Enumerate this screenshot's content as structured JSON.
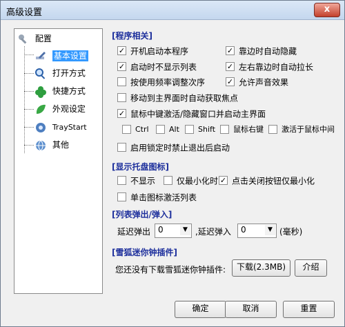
{
  "window": {
    "title": "高级设置",
    "close_symbol": "x"
  },
  "tree": {
    "root": "配置",
    "items": [
      {
        "label": "基本设置",
        "icon": "pen-icon",
        "selected": true
      },
      {
        "label": "打开方式",
        "icon": "magnifier-icon"
      },
      {
        "label": "快捷方式",
        "icon": "clover-icon"
      },
      {
        "label": "外观设定",
        "icon": "leaf-icon"
      },
      {
        "label": "TrayStart",
        "icon": "gear-globe-icon"
      },
      {
        "label": "其他",
        "icon": "globe-icon"
      }
    ]
  },
  "sections": {
    "program": "[程序相关]",
    "tray": "[显示托盘图标]",
    "list": "[列表弹出/弹入]",
    "plugin": "[雪狐迷你钟插件]"
  },
  "program_options": [
    {
      "label": "开机启动本程序",
      "checked": true
    },
    {
      "label": "靠边时自动隐藏",
      "checked": true
    },
    {
      "label": "启动时不显示列表",
      "checked": true
    },
    {
      "label": "左右靠边时自动拉长",
      "checked": true
    },
    {
      "label": "按使用频率调整次序",
      "checked": false
    },
    {
      "label": "允许声音效果",
      "checked": true
    },
    {
      "label": "移动到主界面时自动获取焦点",
      "checked": false
    },
    {
      "label": "鼠标中键激活/隐藏窗口并启动主界面",
      "checked": true
    }
  ],
  "hotkey_modifiers": [
    {
      "label": "Ctrl",
      "checked": false
    },
    {
      "label": "Alt",
      "checked": false
    },
    {
      "label": "Shift",
      "checked": false
    },
    {
      "label": "鼠标右键",
      "checked": false
    },
    {
      "label": "激活于鼠标中间",
      "checked": false
    }
  ],
  "lock_option": {
    "label": "启用锁定时禁止退出后启动",
    "checked": false
  },
  "tray_options": [
    {
      "label": "不显示",
      "checked": false
    },
    {
      "label": "仅最小化时",
      "checked": false
    },
    {
      "label": "点击关闭按钮仅最小化",
      "checked": true
    },
    {
      "label": "单击图标激活列表",
      "checked": false
    }
  ],
  "list_delay": {
    "popup_label": "延迟弹出",
    "popup_value": "0",
    "hide_label": ",延迟弹入",
    "hide_value": "0",
    "unit": "(毫秒)"
  },
  "plugin": {
    "text": "您还没有下载雪狐迷你钟插件:",
    "download": "下载(2.3MB)",
    "intro": "介绍"
  },
  "footer": {
    "ok": "确定",
    "cancel": "取消",
    "apply": "重置"
  }
}
